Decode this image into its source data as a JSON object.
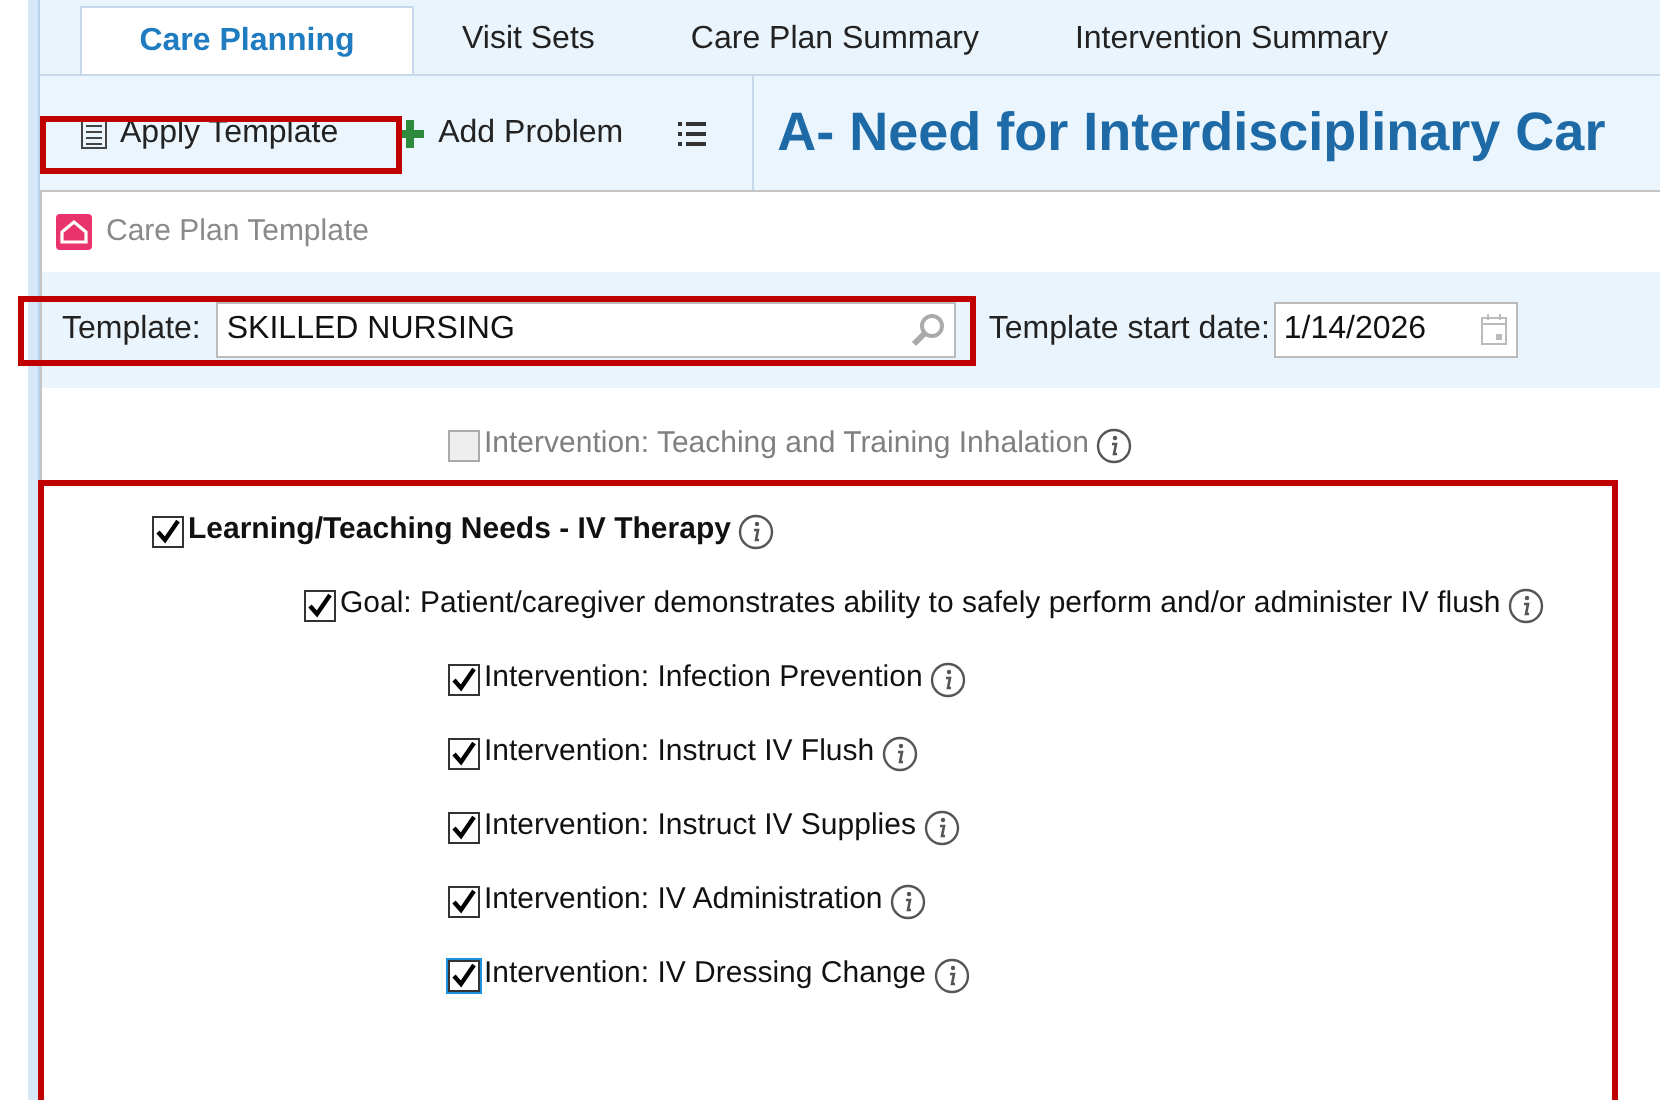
{
  "tabs": [
    {
      "label": "Care Planning",
      "selected": true
    },
    {
      "label": "Visit Sets",
      "selected": false
    },
    {
      "label": "Care Plan Summary",
      "selected": false
    },
    {
      "label": "Intervention Summary",
      "selected": false
    }
  ],
  "toolbar": {
    "apply_template": "Apply Template",
    "add_problem": "Add Problem"
  },
  "heading": "A- Need for Interdisciplinary Car",
  "dialog": {
    "title": "Care Plan Template",
    "template_label": "Template:",
    "template_value": "SKILLED NURSING",
    "start_date_label": "Template start date:",
    "start_date_value": "1/14/2026"
  },
  "tree": [
    {
      "kind": "intervention",
      "label": "Intervention: Teaching and Training Inhalation",
      "checked": false,
      "disabled": true,
      "focused": false
    },
    {
      "kind": "problem",
      "label": "Learning/Teaching Needs - IV Therapy",
      "checked": true,
      "disabled": false,
      "focused": false,
      "children": [
        {
          "kind": "goal",
          "label": "Goal: Patient/caregiver demonstrates ability to safely perform and/or administer IV flush",
          "checked": true,
          "disabled": false,
          "focused": false,
          "children": [
            {
              "kind": "intervention",
              "label": "Intervention: Infection Prevention",
              "checked": true,
              "disabled": false,
              "focused": false
            },
            {
              "kind": "intervention",
              "label": "Intervention: Instruct IV Flush",
              "checked": true,
              "disabled": false,
              "focused": false
            },
            {
              "kind": "intervention",
              "label": "Intervention: Instruct IV Supplies",
              "checked": true,
              "disabled": false,
              "focused": false
            },
            {
              "kind": "intervention",
              "label": "Intervention: IV Administration",
              "checked": true,
              "disabled": false,
              "focused": false
            },
            {
              "kind": "intervention",
              "label": "Intervention: IV Dressing Change",
              "checked": true,
              "disabled": false,
              "focused": true
            }
          ]
        }
      ]
    }
  ]
}
